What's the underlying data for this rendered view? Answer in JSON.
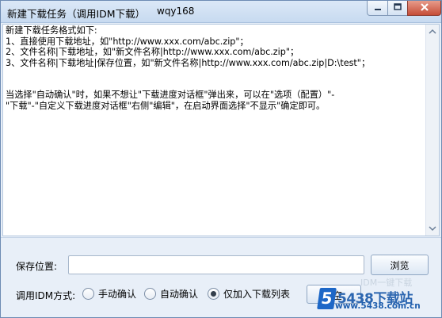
{
  "window": {
    "title": "新建下载任务（调用IDM下载）",
    "user": "wqy168",
    "controls": {
      "minimize_icon": "minimize-icon",
      "maximize_icon": "maximize-icon",
      "close_icon": "close-icon"
    }
  },
  "instructions": {
    "lines": [
      "新建下载任务格式如下:",
      "1、直接使用下载地址，如\"http://www.xxx.com/abc.zip\"；",
      "2、文件名称|下载地址，如\"新文件名称|http://www.xxx.com/abc.zip\"；",
      "3、文件名称|下载地址|保存位置，如\"新文件名称|http://www.xxx.com/abc.zip|D:\\test\"；",
      "",
      "",
      "当选择\"自动确认\"时，如果不想让\"下载进度对话框\"弹出来，可以在\"选项（配置）\"-",
      "\"下载\"-\"自定义下载进度对话框\"右侧\"编辑\"，在启动界面选择\"不显示\"确定即可。"
    ]
  },
  "save": {
    "label": "保存位置:",
    "value": "",
    "placeholder": "",
    "browse_label": "浏览"
  },
  "mode": {
    "label": "调用IDM方式:",
    "options": [
      {
        "label": "手动确认",
        "checked": false
      },
      {
        "label": "自动确认",
        "checked": false
      },
      {
        "label": "仅加入下载列表",
        "checked": true
      }
    ],
    "start_label": "空"
  },
  "watermark": {
    "badge": "5",
    "site_big": "5438下载站",
    "site_small": "www.5438.com.cn",
    "faint": "IDM一键下载"
  }
}
